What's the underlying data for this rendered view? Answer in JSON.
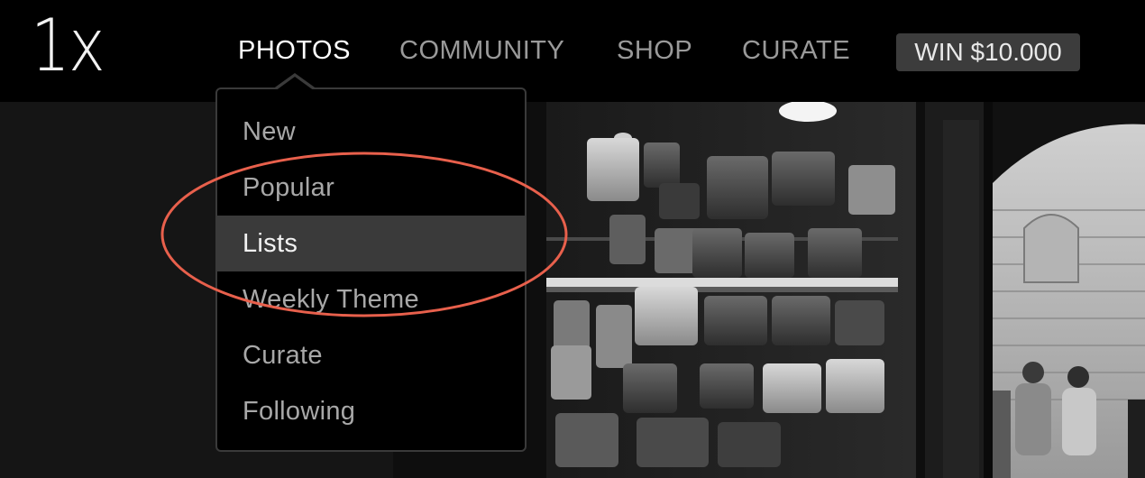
{
  "logo": "1x",
  "nav": {
    "photos": "PHOTOS",
    "community": "COMMUNITY",
    "shop": "SHOP",
    "curate": "CURATE",
    "win": "WIN $10.000"
  },
  "dropdown": {
    "items": [
      {
        "label": "New"
      },
      {
        "label": "Popular"
      },
      {
        "label": "Lists"
      },
      {
        "label": "Weekly Theme"
      },
      {
        "label": "Curate"
      },
      {
        "label": "Following"
      }
    ],
    "highlighted_index": 2
  },
  "colors": {
    "annotation": "#e8604c",
    "highlight": "#3a3a3a",
    "win_bg": "#3c3c3c"
  }
}
